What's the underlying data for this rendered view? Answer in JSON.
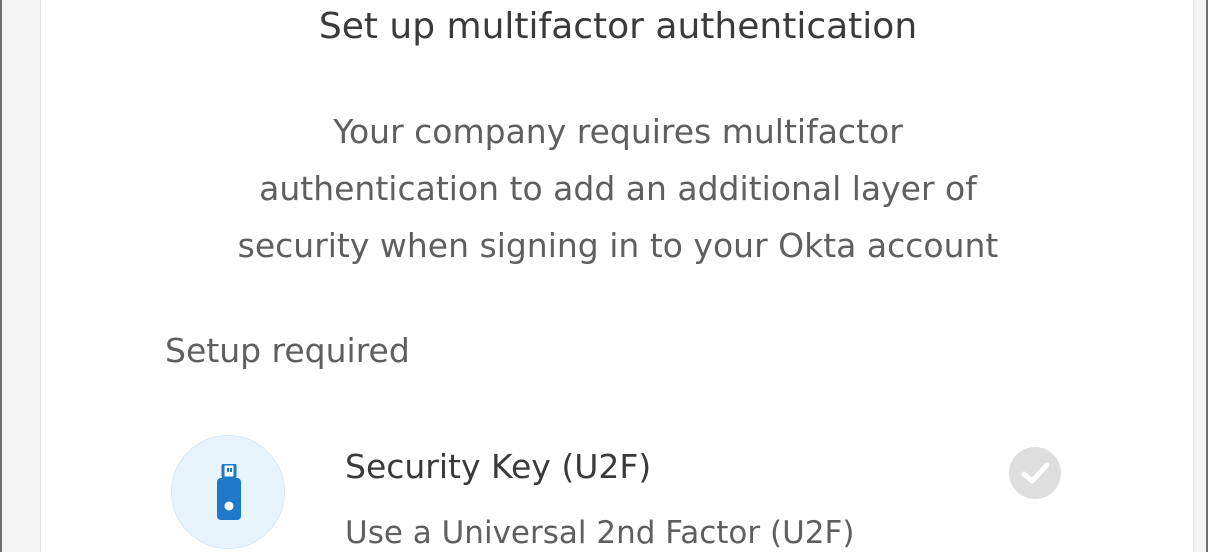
{
  "header": {
    "title": "Set up multifactor authentication"
  },
  "intro": {
    "lines": [
      "Your company requires multifactor",
      "authentication to add an additional layer of",
      "security when signing in to your Okta account"
    ]
  },
  "setup": {
    "section_label": "Setup required",
    "factors": [
      {
        "name": "Security Key (U2F)",
        "description": "Use a Universal 2nd Factor (U2F)",
        "icon": "usb-key-icon",
        "status_icon": "check-circle-icon"
      }
    ]
  },
  "colors": {
    "icon_background": "#e8f4fc",
    "icon_accent": "#1f78c8",
    "check_background": "#dedede"
  }
}
